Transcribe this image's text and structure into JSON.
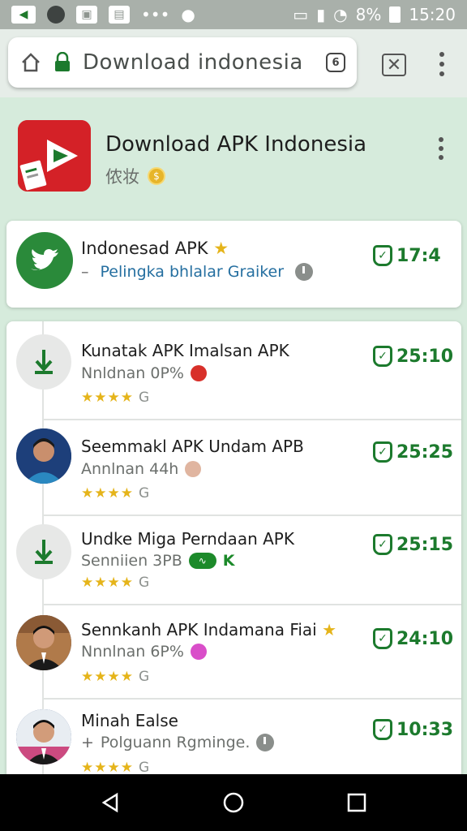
{
  "status_bar": {
    "battery": "8%",
    "time": "15:20"
  },
  "browser": {
    "url": "Download indonesia",
    "tab_count": "6"
  },
  "app": {
    "title": "Download APK Indonesia",
    "subtitle": "侬妆"
  },
  "featured": {
    "title": "Indonesad APK",
    "subtitle": "Pelingka bhlalar Graiker",
    "time": "17:4"
  },
  "items": [
    {
      "title": "Kunatak APK Imalsan APK",
      "subtitle": "Nnldnan 0P%",
      "time": "25:10",
      "rating_suffix": "G"
    },
    {
      "title": "Seemmakl APK Undam APB",
      "subtitle": "Annlnan 44h",
      "time": "25:25",
      "rating_suffix": "G"
    },
    {
      "title": "Undke Miga Perndaan APK",
      "subtitle": "Senniien 3PB",
      "badge": "K",
      "time": "25:15",
      "rating_suffix": "G"
    },
    {
      "title": "Sennkanh APK Indamana Fiai",
      "subtitle": "Nnnlnan 6P%",
      "time": "24:10",
      "rating_suffix": "G"
    },
    {
      "title": "Minah Ealse",
      "subtitle": "Polguann Rgminge.",
      "time": "10:33",
      "rating_suffix": "G"
    }
  ],
  "colors": {
    "brand_green": "#1c7a2d",
    "background": "#d6ebdc",
    "app_icon_red": "#d42127"
  }
}
